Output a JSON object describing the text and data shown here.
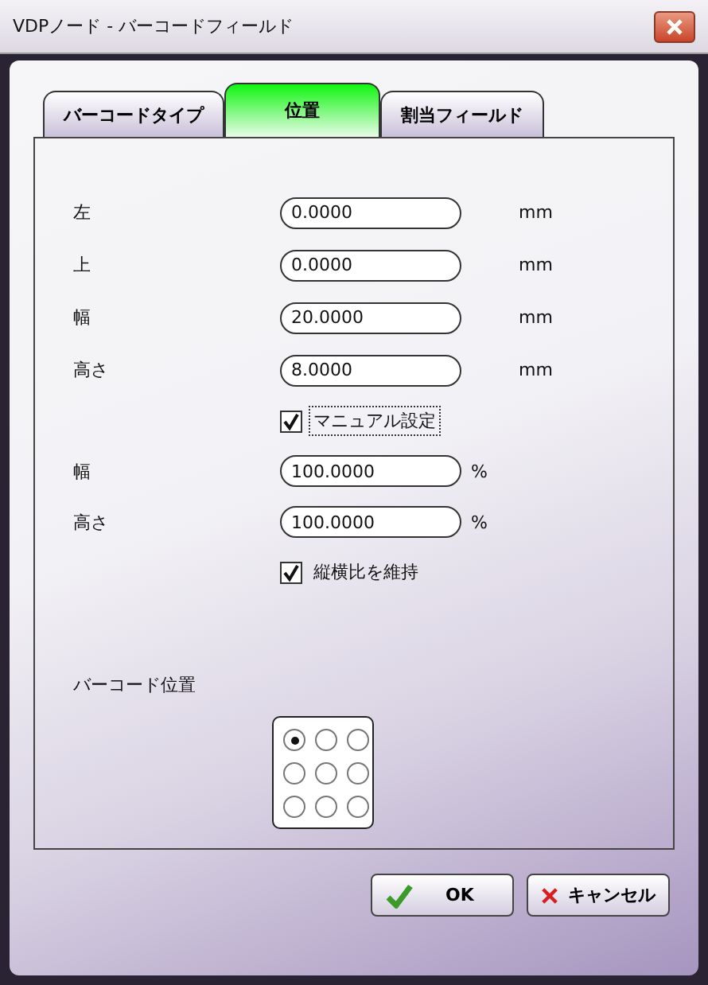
{
  "window": {
    "title": "VDPノード - バーコードフィールド"
  },
  "tabs": [
    {
      "label": "バーコードタイプ",
      "selected": false
    },
    {
      "label": "位置",
      "selected": true
    },
    {
      "label": "割当フィールド",
      "selected": false
    }
  ],
  "rows": [
    {
      "kind": "field",
      "label": "左",
      "value": "0.0000",
      "unit": "mm"
    },
    {
      "kind": "field",
      "label": "上",
      "value": "0.0000",
      "unit": "mm"
    },
    {
      "kind": "field",
      "label": "幅",
      "value": "20.0000",
      "unit": "mm"
    },
    {
      "kind": "field",
      "label": "高さ",
      "value": "8.0000",
      "unit": "mm"
    },
    {
      "kind": "checkbox",
      "label": "マニュアル設定",
      "checked": true,
      "focused": true
    },
    {
      "kind": "percent",
      "label": "幅",
      "value": "100.0000",
      "unit": "%"
    },
    {
      "kind": "percent",
      "label": "高さ",
      "value": "100.0000",
      "unit": "%"
    },
    {
      "kind": "checkbox",
      "label": "縦横比を維持",
      "checked": true,
      "focused": false
    }
  ],
  "position": {
    "label": "バーコード位置",
    "options": [
      {
        "selected": true
      },
      {
        "selected": false
      },
      {
        "selected": false
      },
      {
        "selected": false
      },
      {
        "selected": false
      },
      {
        "selected": false
      },
      {
        "selected": false
      },
      {
        "selected": false
      },
      {
        "selected": false
      }
    ]
  },
  "buttons": [
    {
      "kind": "ok",
      "label": "OK"
    },
    {
      "kind": "cancel",
      "label": "キャンセル"
    }
  ]
}
